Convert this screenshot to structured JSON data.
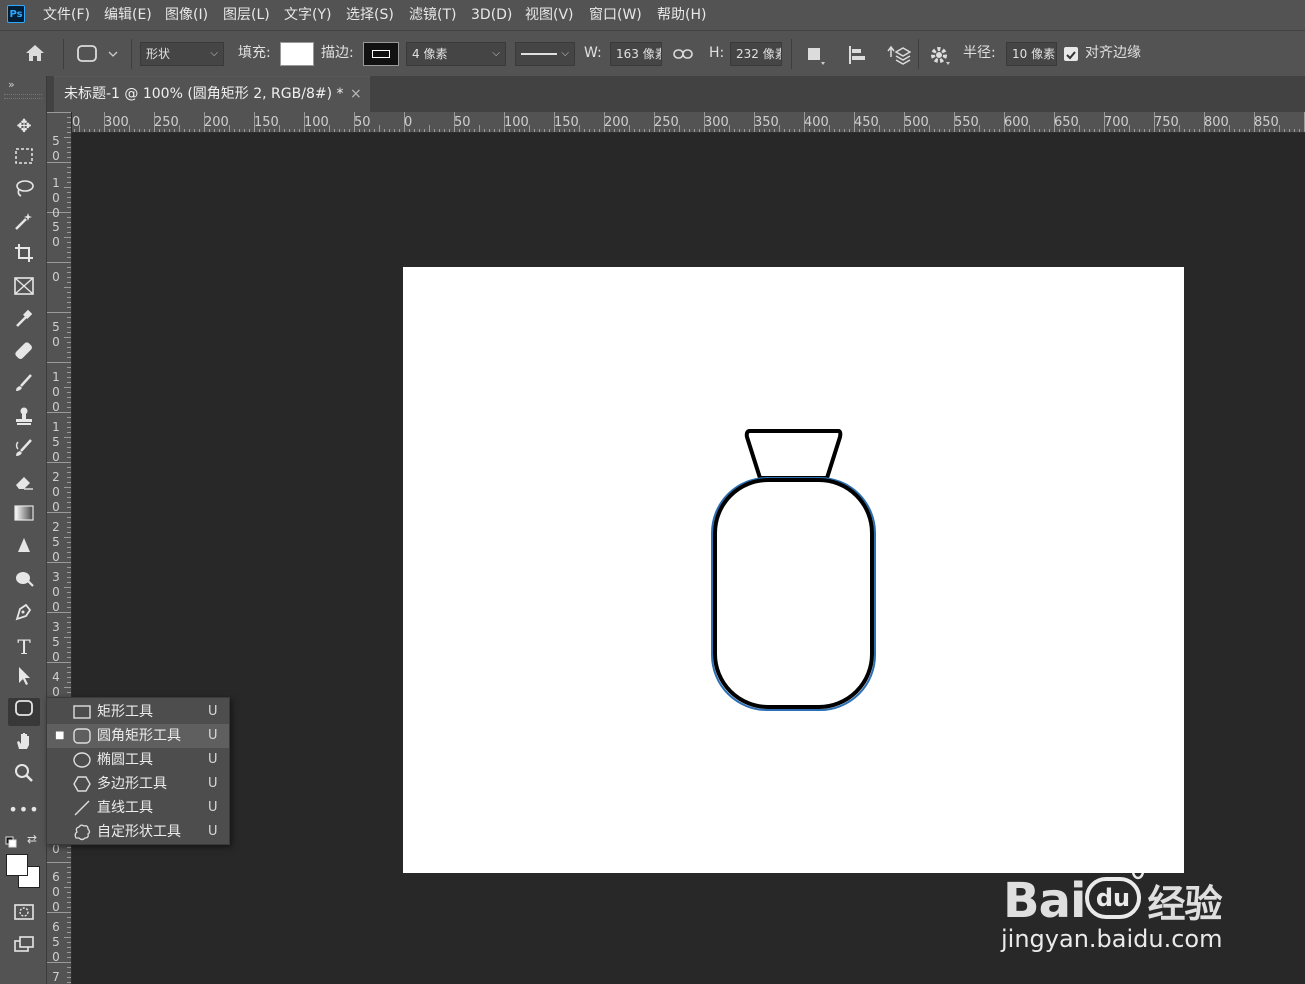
{
  "app": {
    "logo": "Ps"
  },
  "menu": [
    "文件(F)",
    "编辑(E)",
    "图像(I)",
    "图层(L)",
    "文字(Y)",
    "选择(S)",
    "滤镜(T)",
    "3D(D)",
    "视图(V)",
    "窗口(W)",
    "帮助(H)"
  ],
  "options": {
    "mode": "形状",
    "fill_label": "填充:",
    "stroke_label": "描边:",
    "stroke_width": "4 像素",
    "w_label": "W:",
    "w_value": "163 像素",
    "h_label": "H:",
    "h_value": "232 像素",
    "radius_label": "半径:",
    "radius_value": "10 像素",
    "align_edges_label": "对齐边缘",
    "align_edges_checked": true
  },
  "document_tab": {
    "title": "未标题-1 @ 100% (圆角矩形 2, RGB/8#) *",
    "close": "×"
  },
  "rulers": {
    "horizontal": [
      "0",
      "300",
      "250",
      "200",
      "150",
      "100",
      "50",
      "0",
      "50",
      "100",
      "150",
      "200",
      "250",
      "300",
      "350",
      "400",
      "450",
      "500",
      "550",
      "600",
      "650",
      "700",
      "750",
      "800",
      "850"
    ],
    "vertical": [
      "5 0",
      "1 0 0",
      "5 0",
      "0",
      "5 0",
      "1 0 0",
      "1 5 0",
      "2 0 0",
      "2 5 0",
      "3 0 0",
      "3 5 0",
      "4 0",
      "0",
      "6 0 0",
      "6 5 0",
      "7"
    ]
  },
  "flyout": [
    {
      "label": "矩形工具",
      "key": "U",
      "icon": "rectangle-icon",
      "selected": false
    },
    {
      "label": "圆角矩形工具",
      "key": "U",
      "icon": "rounded-rectangle-icon",
      "selected": true
    },
    {
      "label": "椭圆工具",
      "key": "U",
      "icon": "ellipse-icon",
      "selected": false
    },
    {
      "label": "多边形工具",
      "key": "U",
      "icon": "polygon-icon",
      "selected": false
    },
    {
      "label": "直线工具",
      "key": "U",
      "icon": "line-icon",
      "selected": false
    },
    {
      "label": "自定形状工具",
      "key": "U",
      "icon": "custom-shape-icon",
      "selected": false
    }
  ],
  "tools": [
    "move-icon",
    "marquee-icon",
    "lasso-icon",
    "magic-wand-icon",
    "crop-icon",
    "frame-icon",
    "eyedropper-icon",
    "healing-icon",
    "brush-icon",
    "stamp-icon",
    "history-brush-icon",
    "eraser-icon",
    "gradient-icon",
    "blur-icon",
    "dodge-icon",
    "pen-icon",
    "type-icon",
    "path-select-icon",
    "rounded-rectangle-icon",
    "hand-icon",
    "zoom-icon",
    "more-icon"
  ],
  "watermark": {
    "brand": "Bai",
    "brand2": "经验",
    "url": "jingyan.baidu.com"
  },
  "colors": {
    "menubar": "#535353",
    "workspace": "#282828",
    "canvas": "#ffffff",
    "selection_outline": "#2d6fb3"
  }
}
